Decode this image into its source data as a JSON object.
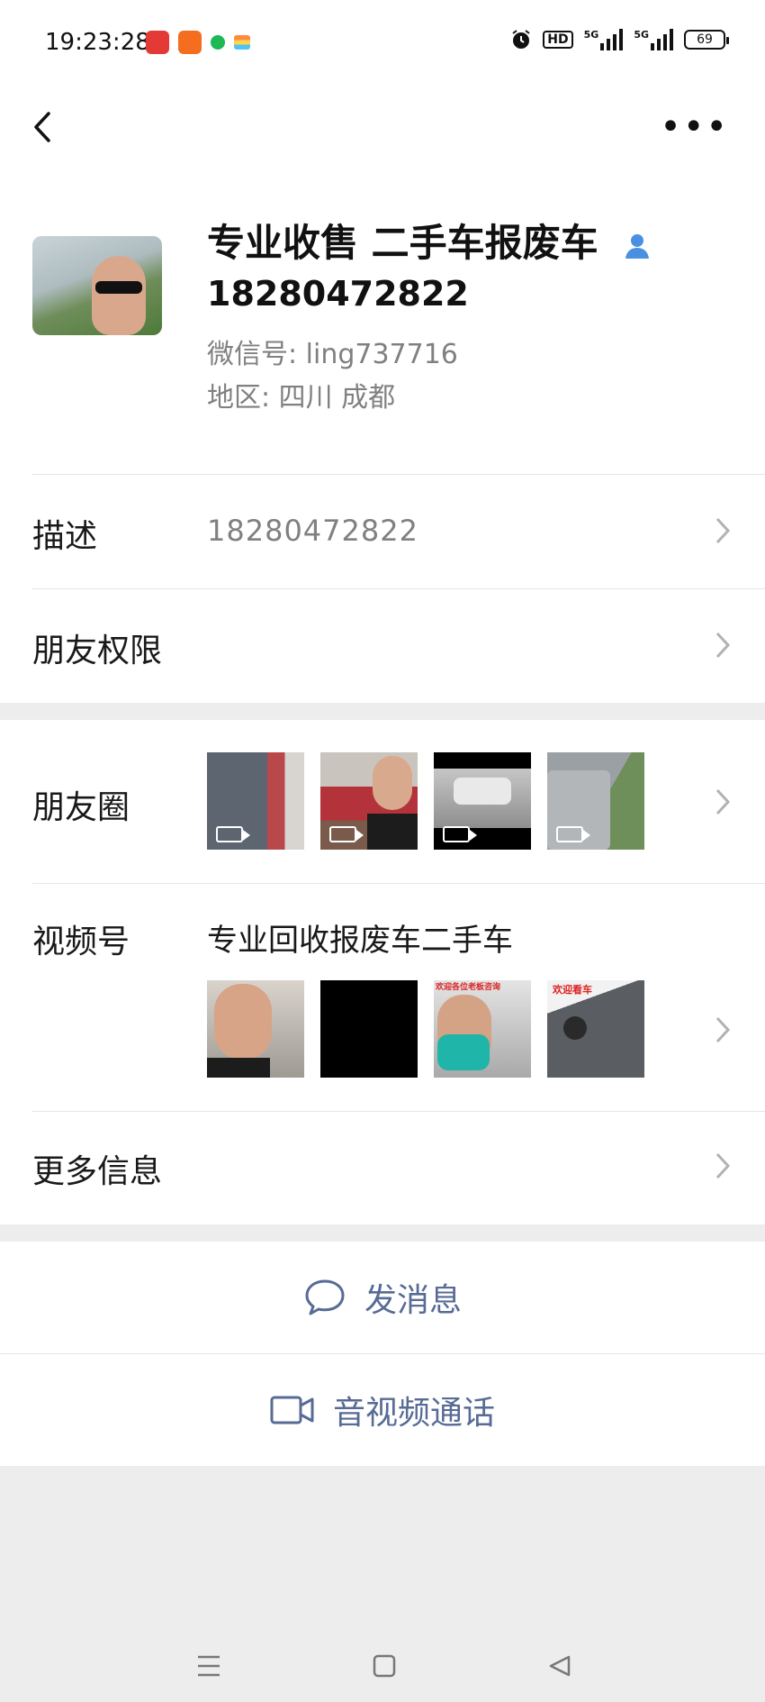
{
  "status_bar": {
    "time": "19:23:28",
    "network_hd": "HD",
    "network_5g_1": "5G",
    "network_5g_2": "5G",
    "battery": "69"
  },
  "profile": {
    "display_name": "专业收售 二手车报废车",
    "phone": "18280472822",
    "wechat_id": "微信号: ling737716",
    "region": "地区: 四川  成都"
  },
  "rows": {
    "description_label": "描述",
    "description_value": "18280472822",
    "permissions_label": "朋友权限",
    "moments_label": "朋友圈",
    "channels_label": "视频号",
    "channels_title": "专业回收报废车二手车",
    "channel_thumb3_caption": "欢迎各位老板咨询",
    "channel_thumb4_caption": "欢迎看车",
    "more_info_label": "更多信息"
  },
  "actions": {
    "send_message": "发消息",
    "av_call": "音视频通话"
  },
  "colors": {
    "link_blue": "#576b95",
    "secondary_text": "#808080",
    "background": "#ededed",
    "verified_icon": "#4a90e2"
  }
}
